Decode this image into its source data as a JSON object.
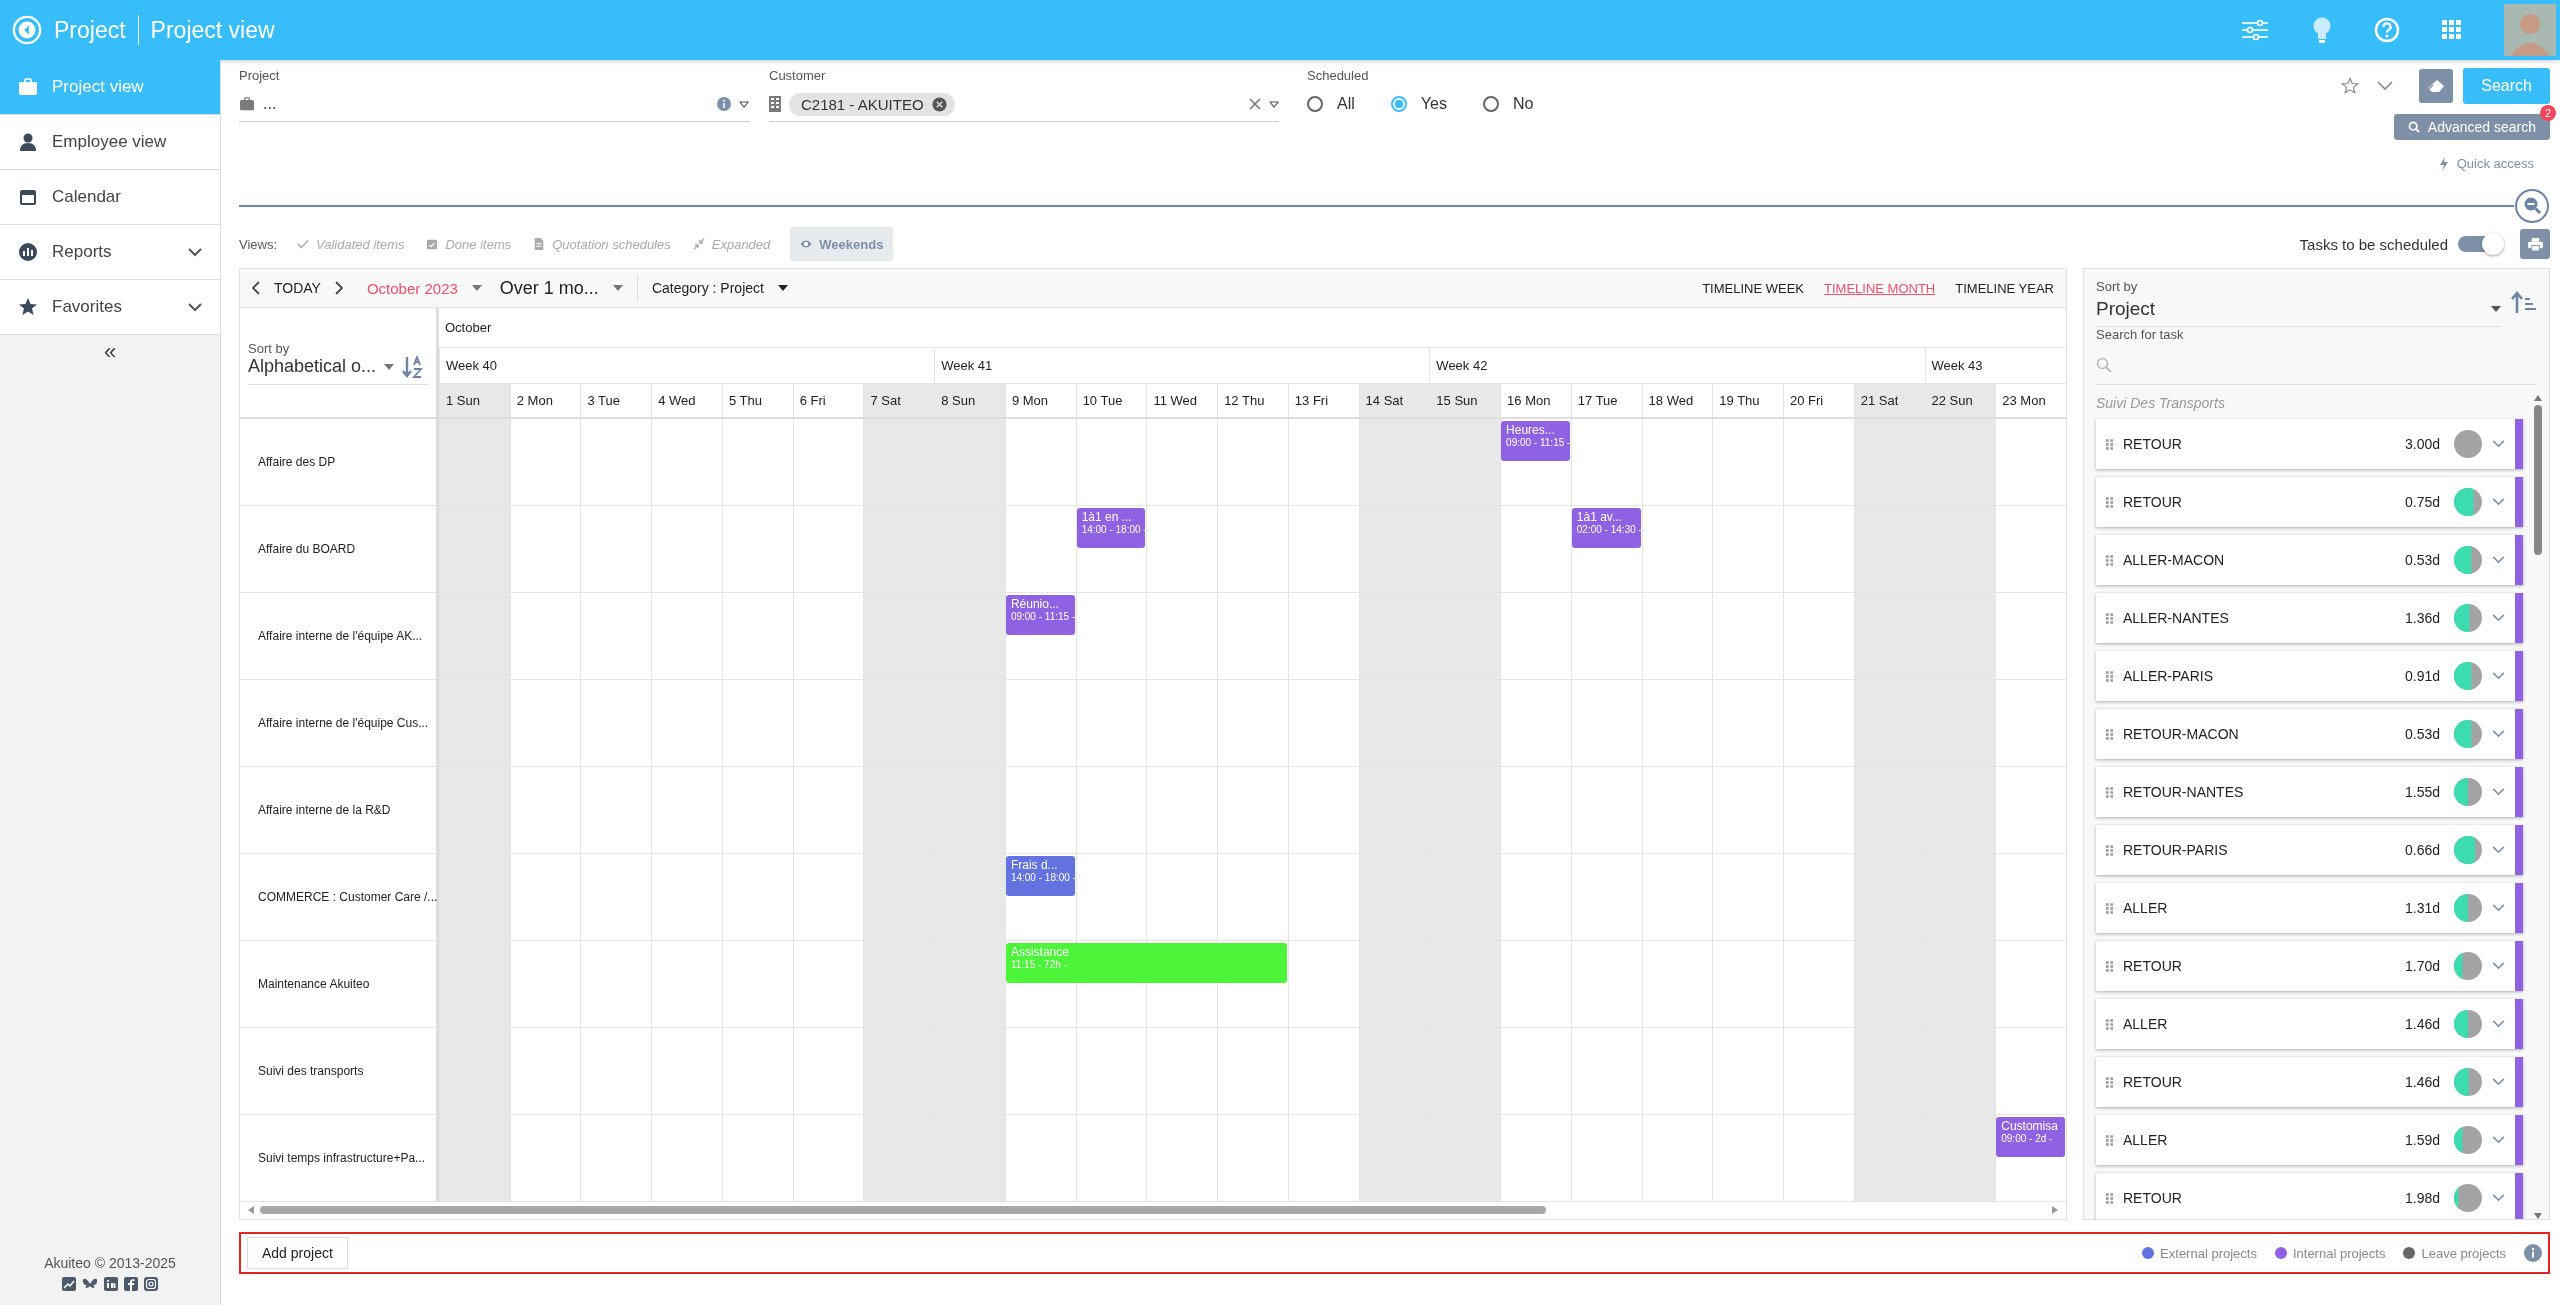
{
  "app": {
    "title": "Project",
    "page": "Project view"
  },
  "sidebar": {
    "items": [
      {
        "label": "Project view",
        "selected": true,
        "expandable": false
      },
      {
        "label": "Employee view",
        "selected": false,
        "expandable": false
      },
      {
        "label": "Calendar",
        "selected": false,
        "expandable": false
      },
      {
        "label": "Reports",
        "selected": false,
        "expandable": true
      },
      {
        "label": "Favorites",
        "selected": false,
        "expandable": true
      }
    ],
    "collapse": "«",
    "footer": "Akuiteo © 2013-2025"
  },
  "filters": {
    "project": {
      "label": "Project",
      "value": "..."
    },
    "customer": {
      "label": "Customer",
      "tag": "C2181 - AKUITEO"
    },
    "scheduled": {
      "label": "Scheduled",
      "options": [
        {
          "label": "All",
          "selected": false
        },
        {
          "label": "Yes",
          "selected": true
        },
        {
          "label": "No",
          "selected": false
        }
      ]
    }
  },
  "actions": {
    "search": "Search",
    "advanced_search": "Advanced search",
    "advanced_badge": "2",
    "quick_access": "Quick access"
  },
  "views": {
    "label": "Views:",
    "items": [
      {
        "label": "Validated items",
        "active": false
      },
      {
        "label": "Done items",
        "active": false
      },
      {
        "label": "Quotation schedules",
        "active": false
      },
      {
        "label": "Expanded",
        "active": false
      },
      {
        "label": "Weekends",
        "active": true
      }
    ]
  },
  "tasks_toggle": {
    "label": "Tasks to be scheduled",
    "on": true
  },
  "calendar": {
    "today": "TODAY",
    "month": "October 2023",
    "range": "Over 1 mo...",
    "category": "Category : Project",
    "modes": [
      {
        "label": "TIMELINE WEEK",
        "selected": false
      },
      {
        "label": "TIMELINE MONTH",
        "selected": true
      },
      {
        "label": "TIMELINE YEAR",
        "selected": false
      }
    ],
    "sort_label": "Sort by",
    "sort_value": "Alphabetical o...",
    "month_label": "October",
    "weeks": [
      {
        "label": "Week 40",
        "days": [
          {
            "label": "1 Sun",
            "weekend": true
          },
          {
            "label": "2 Mon",
            "weekend": false
          },
          {
            "label": "3 Tue",
            "weekend": false
          },
          {
            "label": "4 Wed",
            "weekend": false
          },
          {
            "label": "5 Thu",
            "weekend": false
          },
          {
            "label": "6 Fri",
            "weekend": false
          },
          {
            "label": "7 Sat",
            "weekend": true
          }
        ]
      },
      {
        "label": "Week 41",
        "days": [
          {
            "label": "8 Sun",
            "weekend": true
          },
          {
            "label": "9 Mon",
            "weekend": false
          },
          {
            "label": "10 Tue",
            "weekend": false
          },
          {
            "label": "11 Wed",
            "weekend": false
          },
          {
            "label": "12 Thu",
            "weekend": false
          },
          {
            "label": "13 Fri",
            "weekend": false
          },
          {
            "label": "14 Sat",
            "weekend": true
          }
        ]
      },
      {
        "label": "Week 42",
        "days": [
          {
            "label": "15 Sun",
            "weekend": true
          },
          {
            "label": "16 Mon",
            "weekend": false
          },
          {
            "label": "17 Tue",
            "weekend": false
          },
          {
            "label": "18 Wed",
            "weekend": false
          },
          {
            "label": "19 Thu",
            "weekend": false
          },
          {
            "label": "20 Fri",
            "weekend": false
          },
          {
            "label": "21 Sat",
            "weekend": true
          }
        ]
      },
      {
        "label": "Week 43",
        "days": [
          {
            "label": "22 Sun",
            "weekend": true
          },
          {
            "label": "23 Mon",
            "weekend": false
          }
        ]
      }
    ],
    "rows": [
      {
        "label": "Affaire des DP",
        "cells": [
          null,
          null,
          null,
          null,
          null,
          null,
          null,
          null,
          null,
          null,
          null,
          null,
          null,
          null,
          null,
          {
            "kind": "event",
            "title": "Heures...",
            "time": "09:00 - 11:15 -",
            "color": "#8e62e3"
          },
          null,
          null,
          null,
          null,
          null,
          null,
          null
        ]
      },
      {
        "label": "Affaire du BOARD",
        "cells": [
          null,
          null,
          null,
          null,
          null,
          null,
          null,
          null,
          null,
          {
            "kind": "event",
            "title": "1à1 en ...",
            "time": "14:00 - 18:00 -",
            "color": "#8e62e3"
          },
          null,
          null,
          null,
          null,
          null,
          null,
          {
            "kind": "event",
            "title": "1à1 av...",
            "time": "02:00 - 14:30 -",
            "color": "#8e62e3"
          },
          null,
          null,
          null,
          null,
          null,
          null
        ]
      },
      {
        "label": "Affaire interne de l'équipe AK...",
        "cells": [
          null,
          null,
          null,
          null,
          null,
          null,
          null,
          null,
          {
            "kind": "event",
            "title": "Réunio...",
            "time": "09:00 - 11:15 -",
            "color": "#8e62e3"
          },
          null,
          null,
          null,
          null,
          null,
          null,
          null,
          null,
          null,
          null,
          null,
          null,
          null,
          null
        ]
      },
      {
        "label": "Affaire interne de l'équipe Cus...",
        "cells": [
          null,
          null,
          null,
          null,
          null,
          null,
          null,
          null,
          null,
          null,
          null,
          null,
          null,
          null,
          null,
          null,
          null,
          null,
          null,
          null,
          null,
          null,
          null
        ]
      },
      {
        "label": "Affaire interne de la R&D",
        "cells": [
          null,
          null,
          null,
          null,
          null,
          null,
          null,
          null,
          null,
          null,
          null,
          null,
          null,
          null,
          null,
          null,
          null,
          null,
          null,
          null,
          null,
          null,
          null
        ]
      },
      {
        "label": "COMMERCE : Customer Care /...",
        "cells": [
          null,
          null,
          null,
          null,
          null,
          null,
          null,
          null,
          {
            "kind": "event",
            "title": "Frais d...",
            "time": "14:00 - 18:00 -",
            "color": "#6272e0"
          },
          null,
          null,
          null,
          null,
          null,
          null,
          null,
          null,
          null,
          null,
          null,
          null,
          null,
          null
        ]
      },
      {
        "label": "Maintenance Akuiteo",
        "cells": [
          null,
          null,
          null,
          null,
          null,
          null,
          null,
          null,
          {
            "kind": "event",
            "title": "Assistance",
            "time": "11:15 - 72h -",
            "color": "#4cf43a"
          },
          {
            "kind": "continuation"
          },
          {
            "kind": "continuation"
          },
          {
            "kind": "continuation"
          },
          null,
          null,
          null,
          null,
          null,
          null,
          null,
          null,
          null,
          null,
          null
        ]
      },
      {
        "label": "Suivi des transports",
        "cells": [
          null,
          null,
          null,
          null,
          null,
          null,
          null,
          null,
          null,
          null,
          null,
          null,
          null,
          null,
          null,
          null,
          null,
          null,
          null,
          null,
          null,
          null,
          null
        ]
      },
      {
        "label": "Suivi temps infrastructure+Pa...",
        "cells": [
          null,
          null,
          null,
          null,
          null,
          null,
          null,
          null,
          null,
          null,
          null,
          null,
          null,
          null,
          null,
          null,
          null,
          null,
          null,
          null,
          null,
          null,
          {
            "kind": "event",
            "title": "Customisa",
            "time": "09:00 - 2d -",
            "color": "#8e62e3"
          }
        ]
      }
    ]
  },
  "task_panel": {
    "sort_label": "Sort by",
    "sort_value": "Project",
    "search_label": "Search for task",
    "group": "Suivi Des Transports",
    "tasks": [
      {
        "name": "RETOUR",
        "duration": "3.00d",
        "level": 0
      },
      {
        "name": "RETOUR",
        "duration": "0.75d",
        "level": 0.7
      },
      {
        "name": "ALLER-MACON",
        "duration": "0.53d",
        "level": 0.62
      },
      {
        "name": "ALLER-NANTES",
        "duration": "1.36d",
        "level": 0.55
      },
      {
        "name": "ALLER-PARIS",
        "duration": "0.91d",
        "level": 0.62
      },
      {
        "name": "RETOUR-MACON",
        "duration": "0.53d",
        "level": 0.62
      },
      {
        "name": "RETOUR-NANTES",
        "duration": "1.55d",
        "level": 0.5
      },
      {
        "name": "RETOUR-PARIS",
        "duration": "0.66d",
        "level": 0.75
      },
      {
        "name": "ALLER",
        "duration": "1.31d",
        "level": 0.5
      },
      {
        "name": "RETOUR",
        "duration": "1.70d",
        "level": 0.3
      },
      {
        "name": "ALLER",
        "duration": "1.46d",
        "level": 0.5
      },
      {
        "name": "RETOUR",
        "duration": "1.46d",
        "level": 0.52
      },
      {
        "name": "ALLER",
        "duration": "1.59d",
        "level": 0.3
      },
      {
        "name": "RETOUR",
        "duration": "1.98d",
        "level": 0.15
      }
    ]
  },
  "bottom_bar": {
    "add_project": "Add project",
    "legend": [
      {
        "label": "External projects",
        "color": "#6272e0"
      },
      {
        "label": "Internal projects",
        "color": "#8e62e3"
      },
      {
        "label": "Leave projects",
        "color": "#666666"
      }
    ]
  }
}
